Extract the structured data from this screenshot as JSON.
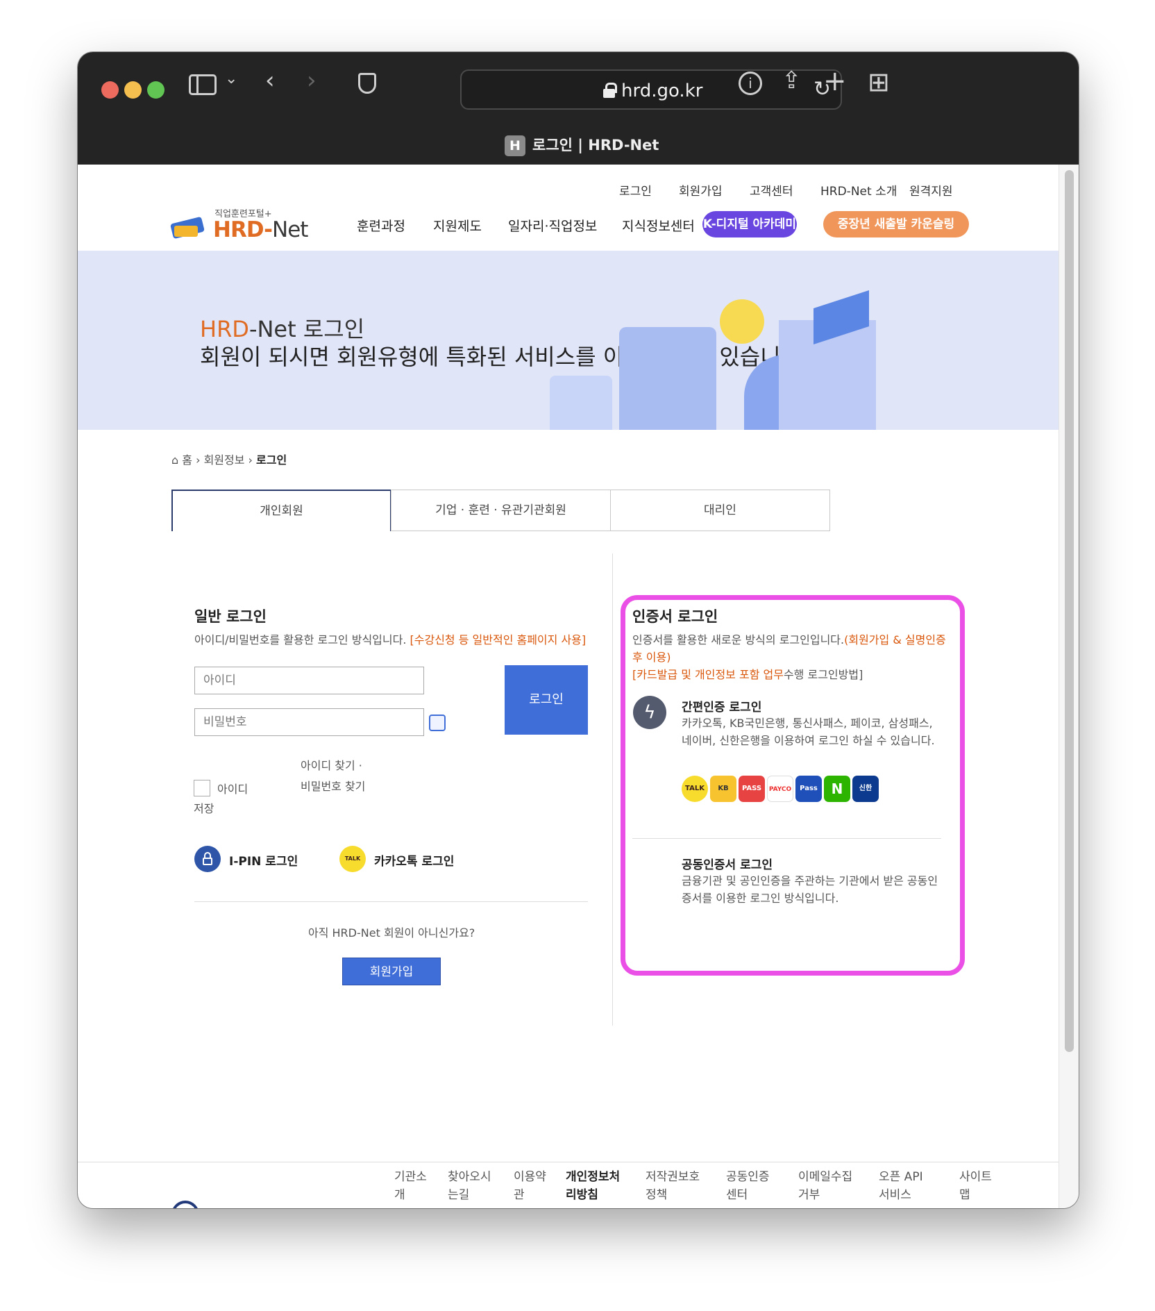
{
  "browser": {
    "url": "hrd.go.kr",
    "tab_title": "로그인 | HRD-Net",
    "favicon": "H"
  },
  "util": [
    "로그인",
    "회원가입",
    "고객센터",
    "HRD-Net 소개",
    "원격지원"
  ],
  "logo": {
    "small": "직업훈련포털+",
    "main": "HRD-",
    "main2": "Net"
  },
  "gnb": [
    "훈련과정",
    "지원제도",
    "일자리·직업정보",
    "지식정보센터"
  ],
  "pill1": "K-디지털 아카데미",
  "pill2": "중장년 새출발 카운슬링",
  "hero": {
    "t1a": "HRD",
    "t1b": "-Net 로그인",
    "t2": "회원이 되시면 회원유형에 특화된 서비스를 이용하실 수 있습니다."
  },
  "crumb": {
    "home": "홈",
    "c1": "회원정보",
    "c2": "로그인"
  },
  "tabs": [
    "개인회원",
    "기업 · 훈련 · 유관기관회원",
    "대리인"
  ],
  "general": {
    "title": "일반 로그인",
    "desc": "아이디/비밀번호를 활용한 로그인 방식입니다. ",
    "desc_o": "[수강신청 등 일반적인 홈페이지 사용]",
    "id_ph": "아이디",
    "pw_ph": "비밀번호",
    "login": "로그인",
    "find1": "아이디 찾기  ·",
    "find2": "비밀번호 찾기",
    "save1": "아이디",
    "save2": "저장",
    "ipin": "I-PIN 로그인",
    "kakao": "카카오톡 로그인",
    "notyet": "아직 HRD-Net 회원이 아니신가요?",
    "join": "회원가입"
  },
  "cert": {
    "title": "인증서 로그인",
    "desc": "인증서를 활용한 새로운 방식의 로그인입니다.",
    "desc_o": "(회원가입 & 실명인증 후 이용)",
    "desc_o2": "[카드발급 및 개인정보 포함 업무",
    "desc_e": "수행 로그인방법]",
    "simple_t": "간편인증 로그인",
    "simple_d": "카카오톡, KB국민은행, 통신사패스, 페이코, 삼성패스, 네이버, 신한은행을 이용하여 로그인 하실 수 있습니다.",
    "pub_t": "공동인증서 로그인",
    "pub_d": "금융기관 및 공인인증을 주관하는 기관에서 받은 공동인증서를 이용한 로그인 방식입니다.",
    "icons": [
      "TALK",
      "KB",
      "PASS",
      "PAYCO",
      "Pass",
      "N",
      "신한"
    ]
  },
  "footer": [
    "기관소개",
    "찾아오시는길",
    "이용약관",
    "개인정보처리방침",
    "저작권보호정책",
    "공동인증센터",
    "이메일수집거부",
    "오픈 API 서비스",
    "사이트맵"
  ]
}
